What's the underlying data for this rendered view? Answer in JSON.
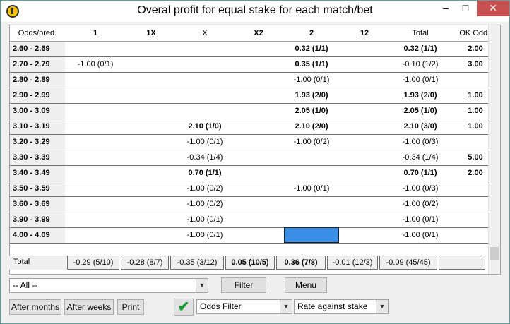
{
  "window": {
    "title": "Overal profit for equal stake for each match/bet",
    "minimize_glyph": "–",
    "maximize_glyph": "□",
    "close_glyph": "✕"
  },
  "table": {
    "headers": [
      "Odds/pred.",
      "1",
      "1X",
      "X",
      "X2",
      "2",
      "12",
      "Total",
      "OK Odds"
    ],
    "rows": [
      {
        "range": "2.60 - 2.69",
        "c1": "",
        "c1x": "",
        "cx": "",
        "cx2": "",
        "c2": "0.32 (1/1)",
        "c12": "",
        "total": "0.32 (1/1)",
        "ok": "2.00"
      },
      {
        "range": "2.70 - 2.79",
        "c1": "-1.00 (0/1)",
        "c1x": "",
        "cx": "",
        "cx2": "",
        "c2": "0.35 (1/1)",
        "c12": "",
        "total": "-0.10 (1/2)",
        "ok": "3.00"
      },
      {
        "range": "2.80 - 2.89",
        "c1": "",
        "c1x": "",
        "cx": "",
        "cx2": "",
        "c2": "-1.00 (0/1)",
        "c12": "",
        "total": "-1.00 (0/1)",
        "ok": ""
      },
      {
        "range": "2.90 - 2.99",
        "c1": "",
        "c1x": "",
        "cx": "",
        "cx2": "",
        "c2": "1.93 (2/0)",
        "c12": "",
        "total": "1.93 (2/0)",
        "ok": "1.00"
      },
      {
        "range": "3.00 - 3.09",
        "c1": "",
        "c1x": "",
        "cx": "",
        "cx2": "",
        "c2": "2.05 (1/0)",
        "c12": "",
        "total": "2.05 (1/0)",
        "ok": "1.00"
      },
      {
        "range": "3.10 - 3.19",
        "c1": "",
        "c1x": "",
        "cx": "2.10 (1/0)",
        "cx2": "",
        "c2": "2.10 (2/0)",
        "c12": "",
        "total": "2.10 (3/0)",
        "ok": "1.00"
      },
      {
        "range": "3.20 - 3.29",
        "c1": "",
        "c1x": "",
        "cx": "-1.00 (0/1)",
        "cx2": "",
        "c2": "-1.00 (0/2)",
        "c12": "",
        "total": "-1.00 (0/3)",
        "ok": ""
      },
      {
        "range": "3.30 - 3.39",
        "c1": "",
        "c1x": "",
        "cx": "-0.34 (1/4)",
        "cx2": "",
        "c2": "",
        "c12": "",
        "total": "-0.34 (1/4)",
        "ok": "5.00"
      },
      {
        "range": "3.40 - 3.49",
        "c1": "",
        "c1x": "",
        "cx": "0.70 (1/1)",
        "cx2": "",
        "c2": "",
        "c12": "",
        "total": "0.70 (1/1)",
        "ok": "2.00"
      },
      {
        "range": "3.50 - 3.59",
        "c1": "",
        "c1x": "",
        "cx": "-1.00 (0/2)",
        "cx2": "",
        "c2": "-1.00 (0/1)",
        "c12": "",
        "total": "-1.00 (0/3)",
        "ok": ""
      },
      {
        "range": "3.60 - 3.69",
        "c1": "",
        "c1x": "",
        "cx": "-1.00 (0/2)",
        "cx2": "",
        "c2": "",
        "c12": "",
        "total": "-1.00 (0/2)",
        "ok": ""
      },
      {
        "range": "3.90 - 3.99",
        "c1": "",
        "c1x": "",
        "cx": "-1.00 (0/1)",
        "cx2": "",
        "c2": "",
        "c12": "",
        "total": "-1.00 (0/1)",
        "ok": ""
      },
      {
        "range": "4.00 - 4.09",
        "c1": "",
        "c1x": "",
        "cx": "-1.00 (0/1)",
        "cx2": "",
        "c2": "",
        "c12": "",
        "total": "-1.00 (0/1)",
        "ok": ""
      }
    ],
    "totals": {
      "label": "Total",
      "c1": "-0.29 (5/10)",
      "c1x": "-0.28 (8/7)",
      "cx": "-0.35 (3/12)",
      "cx2": "0.05 (10/5)",
      "c2": "0.36 (7/8)",
      "c12": "-0.01 (12/3)",
      "total": "-0.09 (45/45)",
      "ok": ""
    }
  },
  "controls": {
    "range_select": "-- All --",
    "filter_label": "Filter",
    "menu_label": "Menu",
    "after_months_label": "After months",
    "after_weeks_label": "After weeks",
    "print_label": "Print",
    "apply_glyph": "✔",
    "odds_filter_select": "Odds Filter",
    "rate_select": "Rate against stake"
  },
  "colors": {
    "selected_cell": "#3a8ee6",
    "check_green": "#17a035"
  }
}
